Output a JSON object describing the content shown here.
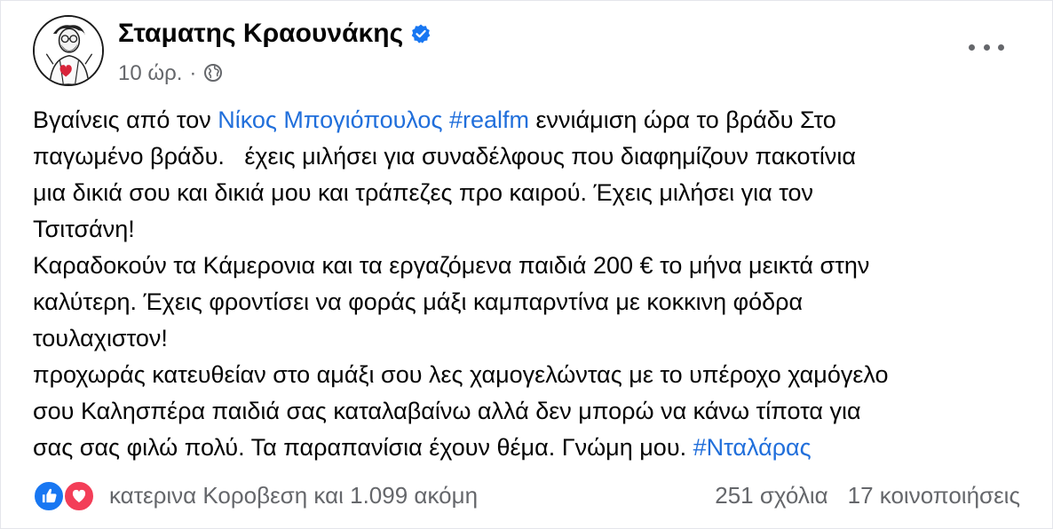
{
  "post": {
    "author": "Σταματης Κραουνάκης",
    "time": "10 ώρ.",
    "separator": "·",
    "privacy_icon": "globe-icon",
    "verified_icon": "verified-badge-icon",
    "more_icon": "more-options-icon",
    "body": {
      "l1_a": "Βγαίνεις από τον ",
      "l1_link1": "Νίκος Μπογιόπουλος",
      "l1_b": " ",
      "l1_link2": "#realfm",
      "l1_c": " εννιάμιση ώρα το βράδυ Στο",
      "l2": "παγωμένο βράδυ.   έχεις μιλήσει για συναδέλφους που διαφημίζουν πακοτίνια",
      "l3": "μια δικιά σου και δικιά μου και τράπεζες προ καιρού. Έχεις μιλήσει για τον",
      "l4": "Τσιτσάνη!",
      "l5": "Καραδοκούν τα Κάμερονια και τα εργαζόμενα παιδιά 200 € το μήνα μεικτά στην",
      "l6": "καλύτερη. Έχεις φροντίσει να φοράς μάξι καμπαρντίνα με κοκκινη φόδρα",
      "l7": "τουλαχιστον!",
      "l8": "προχωράς κατευθείαν στο αμάξι σου λες χαμογελώντας με το υπέροχο χαμόγελο",
      "l9": "σου Καλησπέρα παιδιά σας καταλαβαίνω αλλά δεν μπορώ να κάνω τίποτα για",
      "l10_a": "σας σας φιλώ πολύ. Τα παραπανίσια έχουν θέμα. Γνώμη μου. ",
      "l10_link": "#Νταλάρας"
    },
    "footer": {
      "reactions": [
        "like-icon",
        "love-icon"
      ],
      "reactors": "κατερινα Κοροβεση και 1.099 ακόμη",
      "comments": "251 σχόλια",
      "shares": "17 κοινοποιήσεις"
    }
  },
  "colors": {
    "link": "#216fdb",
    "secondary_text": "#65676b",
    "like": "#1877f2",
    "love": "#f33e58"
  }
}
